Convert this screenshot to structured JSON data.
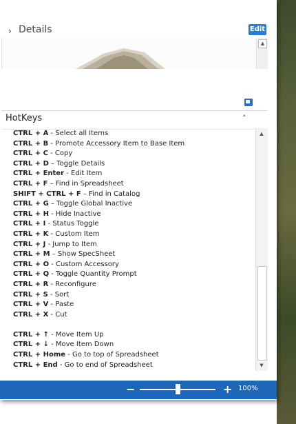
{
  "details": {
    "label": "Details",
    "edit_label": "Edit",
    "expand_icon": "chevron-right-icon"
  },
  "hotkeys": {
    "title": "HotKeys",
    "collapse_icon": "chevron-up-icon",
    "items": [
      {
        "keys": "CTRL + A",
        "desc": " - Select all Items"
      },
      {
        "keys": "CTRL + B",
        "desc": " - Promote Accessory Item to Base Item"
      },
      {
        "keys": "CTRL + C",
        "desc": " - Copy"
      },
      {
        "keys": "CTRL + D",
        "desc": " – Toggle Details"
      },
      {
        "keys": "CTRL + Enter",
        "desc": " - Edit Item"
      },
      {
        "keys": "CTRL + F",
        "desc": " – Find in Spreadsheet"
      },
      {
        "keys": "SHIFT + CTRL + F",
        "desc": " – Find in Catalog"
      },
      {
        "keys": "CTRL + G",
        "desc": " – Toggle Global Inactive"
      },
      {
        "keys": "CTRL + H",
        "desc": " - Hide Inactive"
      },
      {
        "keys": "CTRL + I",
        "desc": " - Status Toggle"
      },
      {
        "keys": "CTRL + K",
        "desc": " - Custom Item"
      },
      {
        "keys": "CTRL + J",
        "desc": " - Jump to Item"
      },
      {
        "keys": "CTRL + M",
        "desc": " – Show SpecSheet"
      },
      {
        "keys": "CTRL + O",
        "desc": " - Custom Accessory"
      },
      {
        "keys": "CTRL + Q",
        "desc": " - Toggle Quantity Prompt"
      },
      {
        "keys": "CTRL + R",
        "desc": " - Reconfigure"
      },
      {
        "keys": "CTRL + S",
        "desc": " - Sort"
      },
      {
        "keys": "CTRL + V",
        "desc": " - Paste"
      },
      {
        "keys": "CTRL + X",
        "desc": " - Cut"
      },
      {
        "keys": "",
        "desc": ""
      },
      {
        "keys": "CTRL + ↑",
        "desc": " - Move Item Up"
      },
      {
        "keys": "CTRL + ↓",
        "desc": " - Move Item Down"
      },
      {
        "keys": "CTRL + Home",
        "desc": " - Go to top of Spreadsheet"
      },
      {
        "keys": "CTRL + End",
        "desc": " - Go to end of Spreadsheet"
      }
    ]
  },
  "status_bar": {
    "zoom_out_symbol": "−",
    "zoom_in_symbol": "+",
    "zoom_level": "100%",
    "zoom_slider_fraction": 0.5
  },
  "colors": {
    "accent": "#1e67b8",
    "edit_button": "#2a7bd1"
  }
}
